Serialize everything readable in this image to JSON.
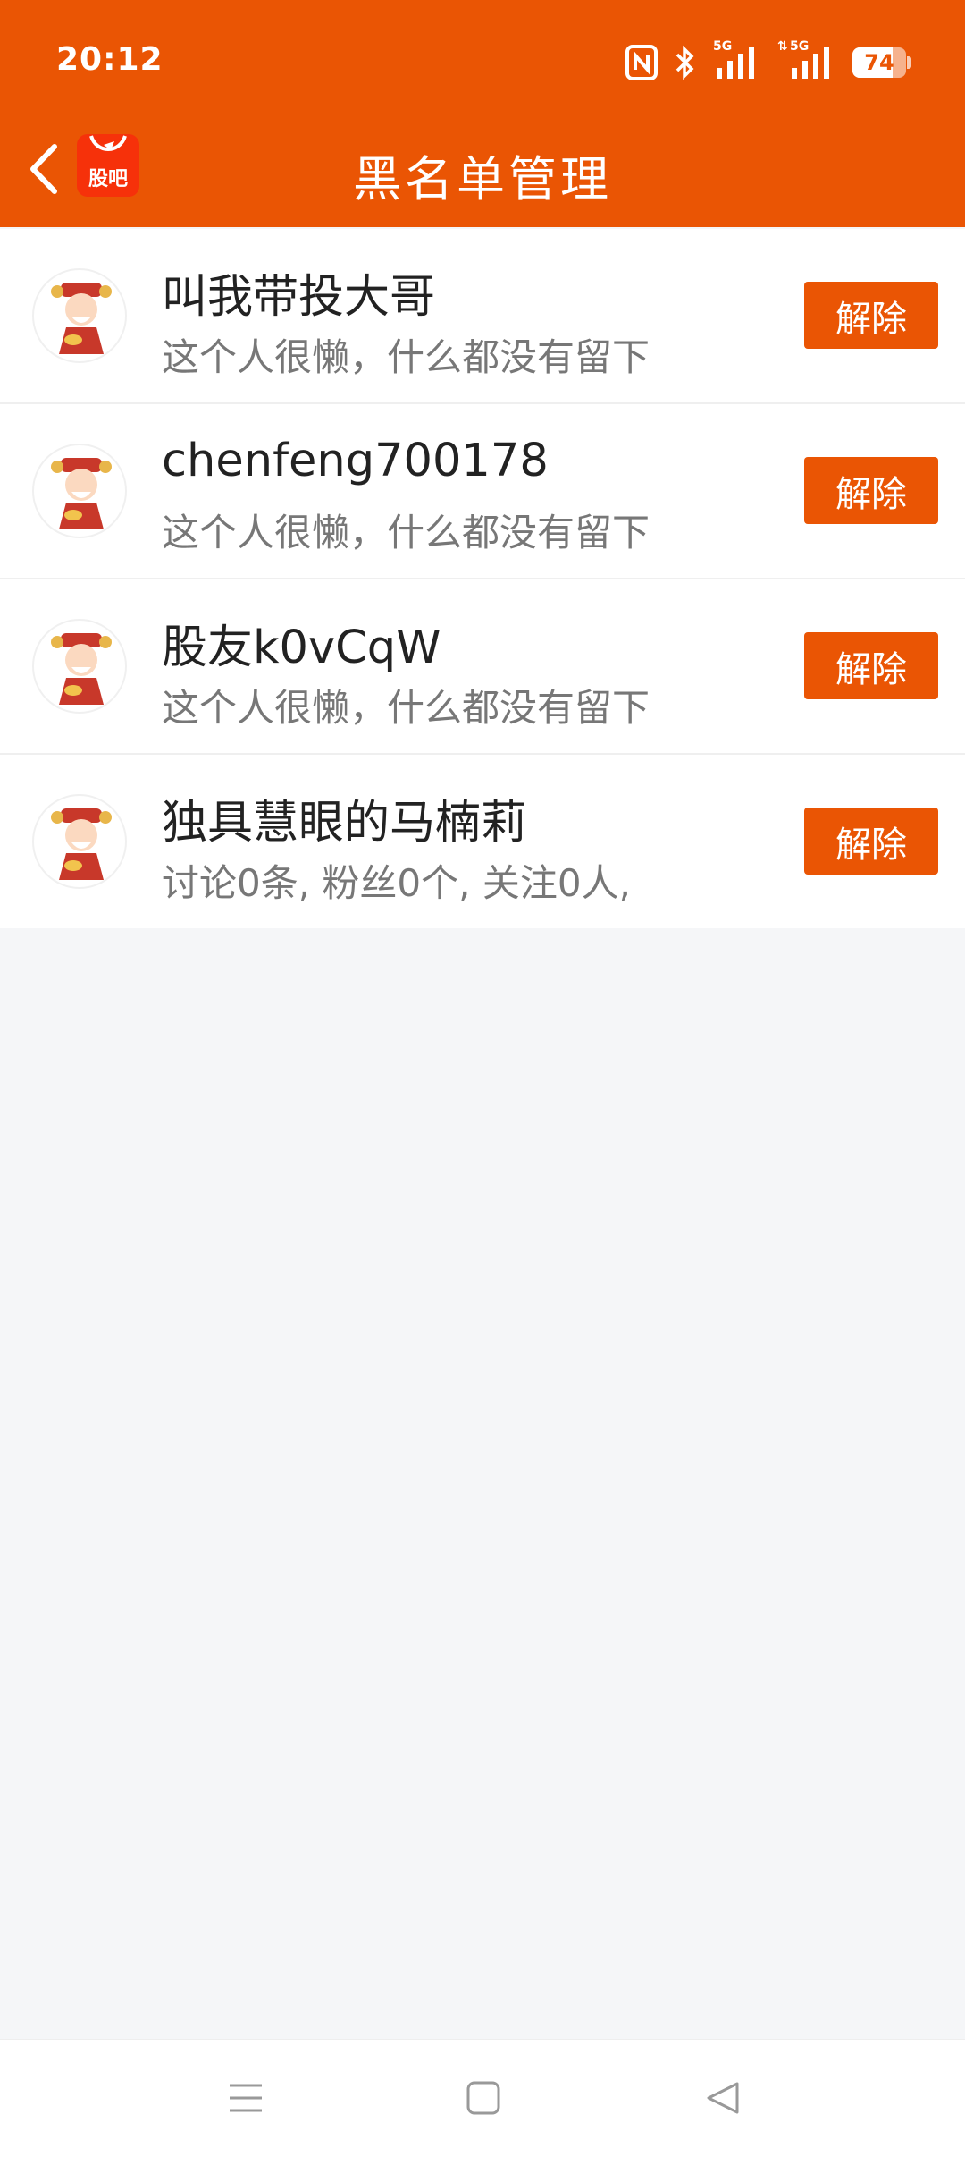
{
  "status_bar": {
    "time": "20:12",
    "battery": "74",
    "network_label_1": "5G",
    "network_label_2": "5G"
  },
  "header": {
    "title": "黑名单管理",
    "app_logo_text": "股吧",
    "accent_color": "#ea5504"
  },
  "blocked_users": [
    {
      "name": "叫我带投大哥",
      "desc": "这个人很懒，什么都没有留下",
      "action": "解除"
    },
    {
      "name": "chenfeng700178",
      "desc": "这个人很懒，什么都没有留下",
      "action": "解除"
    },
    {
      "name": "股友k0vCqW",
      "desc": "这个人很懒，什么都没有留下",
      "action": "解除"
    },
    {
      "name": "独具慧眼的马楠莉",
      "desc": "讨论0条, 粉丝0个, 关注0人,",
      "action": "解除"
    }
  ],
  "icons": {
    "back": "chevron-left-icon",
    "avatar": "caishen-avatar",
    "nav_menu": "menu-icon",
    "nav_home": "square-home-icon",
    "nav_back": "triangle-back-icon"
  }
}
